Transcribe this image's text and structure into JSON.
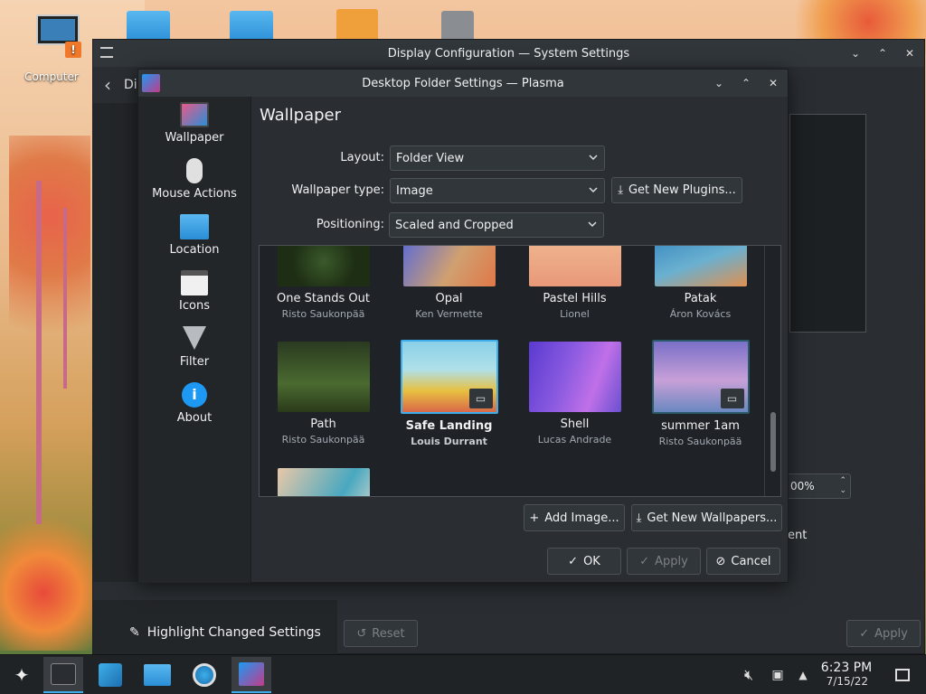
{
  "desktop": {
    "computer_label": "Computer"
  },
  "bg_window": {
    "title": "Display Configuration — System Settings",
    "highlight_label": "Highlight Changed Settings",
    "reset_label": "Reset",
    "apply_label": "Apply",
    "scale_value": "00%",
    "ent_text": "ent"
  },
  "dialog": {
    "title": "Desktop Folder Settings — Plasma",
    "page_title": "Wallpaper",
    "sidebar": [
      {
        "label": "Wallpaper",
        "icon": "monitor-icon"
      },
      {
        "label": "Mouse Actions",
        "icon": "mouse-icon"
      },
      {
        "label": "Location",
        "icon": "folder-icon"
      },
      {
        "label": "Icons",
        "icon": "icons-icon"
      },
      {
        "label": "Filter",
        "icon": "filter-icon"
      },
      {
        "label": "About",
        "icon": "info-icon"
      }
    ],
    "layout_label": "Layout:",
    "layout_value": "Folder View",
    "type_label": "Wallpaper type:",
    "type_value": "Image",
    "plugins_label": "Get New Plugins...",
    "positioning_label": "Positioning:",
    "positioning_value": "Scaled and Cropped",
    "wallpapers": [
      {
        "name": "One Stands Out",
        "author": "Risto Saukonpää"
      },
      {
        "name": "Opal",
        "author": "Ken Vermette"
      },
      {
        "name": "Pastel Hills",
        "author": "Lionel"
      },
      {
        "name": "Patak",
        "author": "Áron Kovács"
      },
      {
        "name": "Path",
        "author": "Risto Saukonpää"
      },
      {
        "name": "Safe Landing",
        "author": "Louis Durrant"
      },
      {
        "name": "Shell",
        "author": "Lucas Andrade"
      },
      {
        "name": "summer 1am",
        "author": "Risto Saukonpää"
      }
    ],
    "add_image_label": "Add Image...",
    "get_wallpapers_label": "Get New Wallpapers...",
    "ok_label": "OK",
    "apply_label": "Apply",
    "cancel_label": "Cancel"
  },
  "taskbar": {
    "time": "6:23 PM",
    "date": "7/15/22"
  }
}
